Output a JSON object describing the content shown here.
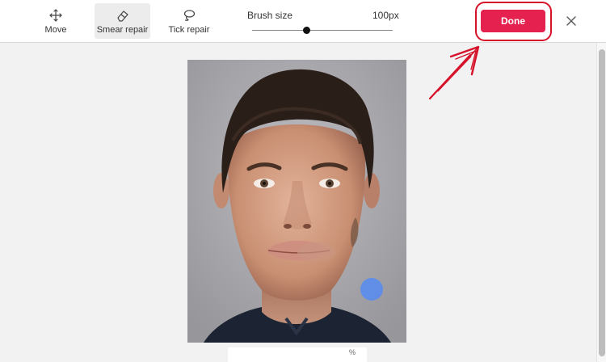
{
  "toolbar": {
    "tools": [
      {
        "label": "Move",
        "icon": "move-icon",
        "active": false
      },
      {
        "label": "Smear repair",
        "icon": "eraser-icon",
        "active": true
      },
      {
        "label": "Tick repair",
        "icon": "lasso-icon",
        "active": false
      }
    ],
    "brush": {
      "label": "Brush size",
      "value": "100px",
      "level": 0.39
    },
    "done_label": "Done",
    "close_icon": "close-icon"
  },
  "canvas": {
    "image_subject": "portrait photo being edited",
    "brush_cursor_color": "#5b8ceb"
  },
  "bottom_bar": {
    "zoom_text": "%"
  },
  "colors": {
    "accent": "#e5224f",
    "annotation": "#d6122a",
    "active_tool_bg": "#ececec"
  }
}
